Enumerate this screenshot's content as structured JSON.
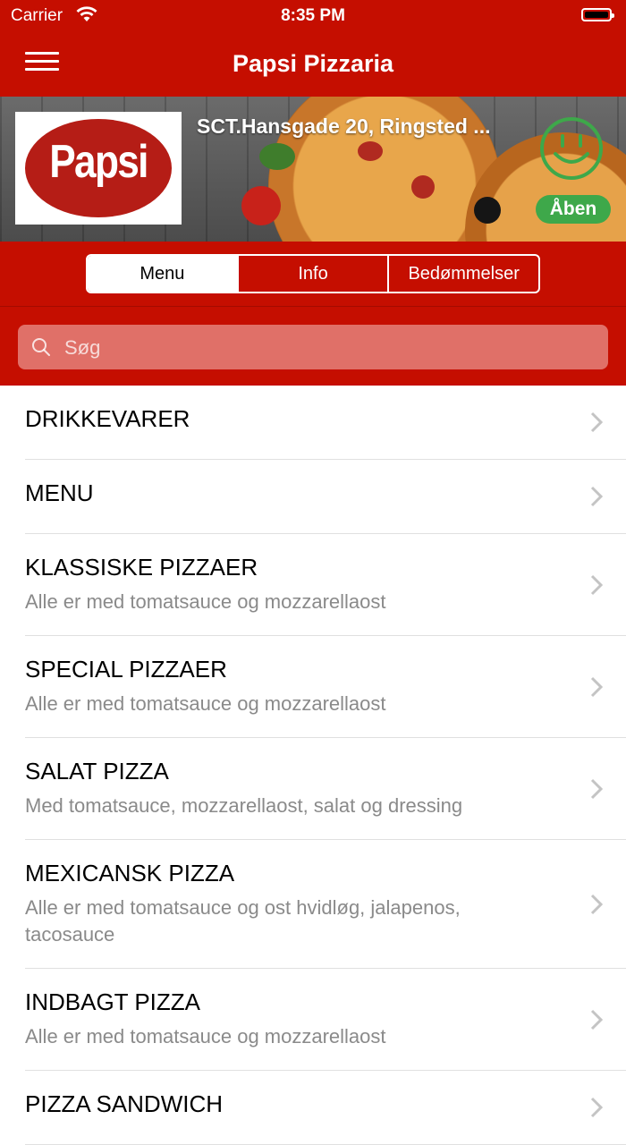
{
  "status_bar": {
    "carrier": "Carrier",
    "time": "8:35 PM"
  },
  "nav": {
    "title": "Papsi Pizzaria",
    "menu_icon": "hamburger-menu-icon"
  },
  "banner": {
    "logo_text": "Papsi",
    "address": "SCT.Hansgade 20, Ringsted ...",
    "status_icon": "smiley-icon",
    "status_label": "Åben"
  },
  "tabs": [
    "Menu",
    "Info",
    "Bedømmelser"
  ],
  "search": {
    "placeholder": "Søg"
  },
  "categories": [
    {
      "title": "DRIKKEVARER",
      "subtitle": ""
    },
    {
      "title": "MENU",
      "subtitle": ""
    },
    {
      "title": "KLASSISKE PIZZAER",
      "subtitle": "Alle er med tomatsauce og mozzarellaost"
    },
    {
      "title": "SPECIAL PIZZAER",
      "subtitle": "Alle er med tomatsauce og mozzarellaost"
    },
    {
      "title": "SALAT PIZZA",
      "subtitle": "Med tomatsauce, mozzarellaost, salat og dressing"
    },
    {
      "title": "MEXICANSK PIZZA",
      "subtitle": "Alle er med tomatsauce og ost hvidløg, jalapenos, tacosauce"
    },
    {
      "title": "INDBAGT PIZZA",
      "subtitle": "Alle er med tomatsauce og mozzarellaost"
    },
    {
      "title": "PIZZA SANDWICH",
      "subtitle": ""
    }
  ],
  "colors": {
    "brand_red": "#c50e00",
    "open_green": "#3ea84a"
  }
}
